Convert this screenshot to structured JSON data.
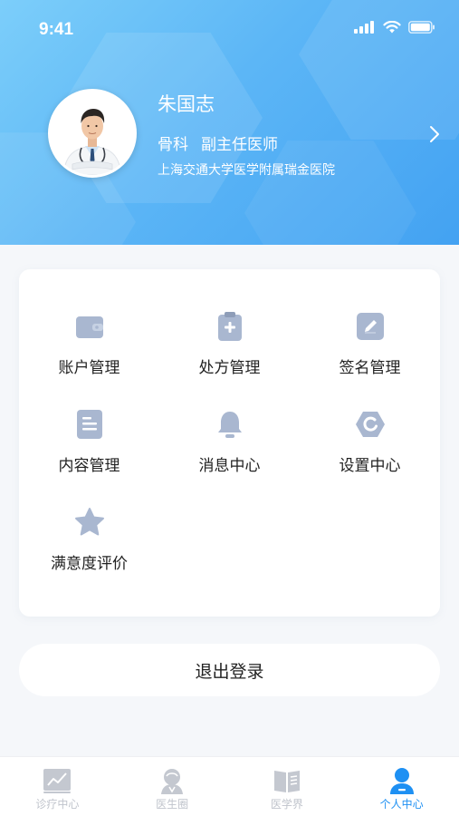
{
  "status_bar": {
    "time": "9:41"
  },
  "profile": {
    "name": "朱国志",
    "department": "骨科",
    "title": "副主任医师",
    "hospital": "上海交通大学医学附属瑞金医院"
  },
  "menu": {
    "items": [
      {
        "label": "账户管理",
        "icon": "wallet-icon"
      },
      {
        "label": "处方管理",
        "icon": "prescription-clipboard-icon"
      },
      {
        "label": "签名管理",
        "icon": "pen-sign-icon"
      },
      {
        "label": "内容管理",
        "icon": "document-icon"
      },
      {
        "label": "消息中心",
        "icon": "bell-icon"
      },
      {
        "label": "设置中心",
        "icon": "settings-hex-icon"
      },
      {
        "label": "满意度评价",
        "icon": "star-icon"
      }
    ]
  },
  "logout": {
    "label": "退出登录"
  },
  "tabbar": {
    "tabs": [
      {
        "label": "诊疗中心",
        "icon": "chart-icon",
        "active": false
      },
      {
        "label": "医生圈",
        "icon": "doctor-circle-icon",
        "active": false
      },
      {
        "label": "医学界",
        "icon": "book-icon",
        "active": false
      },
      {
        "label": "个人中心",
        "icon": "person-icon",
        "active": true
      }
    ]
  },
  "colors": {
    "header_gradient_start": "#7ccefa",
    "header_gradient_end": "#43a2f2",
    "menu_icon": "#a8b8d4",
    "tab_active": "#1e90f3",
    "tab_inactive": "#c0c4cc"
  }
}
